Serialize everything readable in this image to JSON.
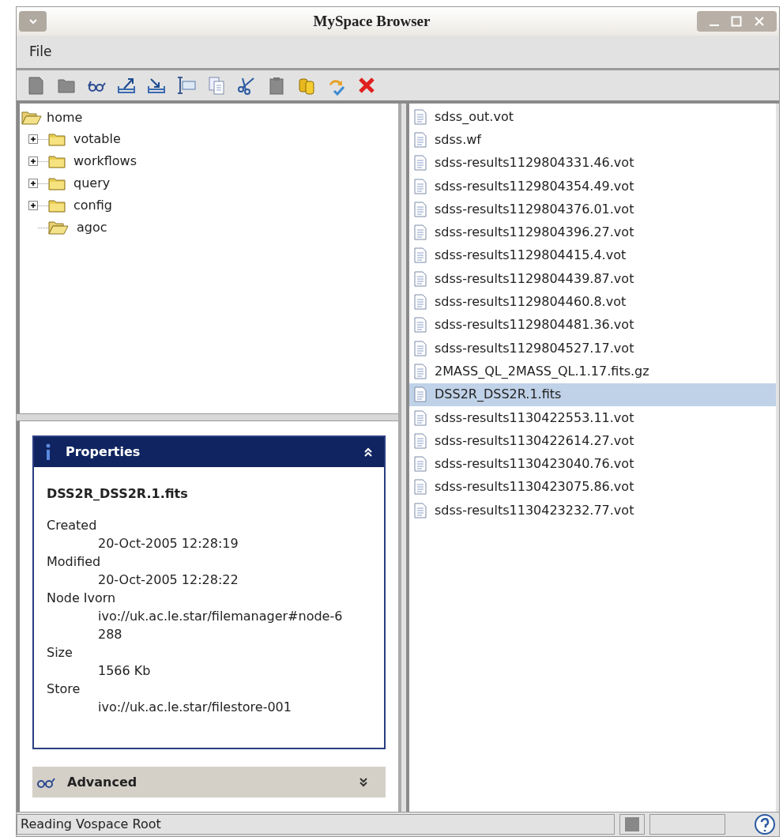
{
  "window": {
    "title": "MySpace Browser"
  },
  "menu": [
    "File"
  ],
  "toolbar": [
    {
      "kind": "new-file",
      "disabled": true
    },
    {
      "kind": "new-folder",
      "disabled": true
    },
    {
      "kind": "view",
      "disabled": false
    },
    {
      "kind": "upload",
      "disabled": false
    },
    {
      "kind": "download",
      "disabled": false
    },
    {
      "kind": "rename",
      "disabled": false
    },
    {
      "kind": "copy",
      "disabled": false
    },
    {
      "kind": "cut",
      "disabled": false
    },
    {
      "kind": "paste",
      "disabled": true
    },
    {
      "kind": "cylinders",
      "disabled": false
    },
    {
      "kind": "refresh",
      "disabled": false
    },
    {
      "kind": "delete",
      "disabled": false
    }
  ],
  "tree": {
    "label": "home",
    "expanded": true,
    "children": [
      {
        "label": "votable",
        "kind": "folder",
        "expanded": false
      },
      {
        "label": "workflows",
        "kind": "folder",
        "expanded": false
      },
      {
        "label": "query",
        "kind": "folder",
        "expanded": false
      },
      {
        "label": "config",
        "kind": "folder",
        "expanded": false
      },
      {
        "label": "agoc",
        "kind": "open-folder"
      }
    ]
  },
  "files": [
    {
      "name": "sdss_out.vot",
      "selected": false
    },
    {
      "name": "sdss.wf",
      "selected": false
    },
    {
      "name": "sdss-results1129804331.46.vot",
      "selected": false
    },
    {
      "name": "sdss-results1129804354.49.vot",
      "selected": false
    },
    {
      "name": "sdss-results1129804376.01.vot",
      "selected": false
    },
    {
      "name": "sdss-results1129804396.27.vot",
      "selected": false
    },
    {
      "name": "sdss-results1129804415.4.vot",
      "selected": false
    },
    {
      "name": "sdss-results1129804439.87.vot",
      "selected": false
    },
    {
      "name": "sdss-results1129804460.8.vot",
      "selected": false
    },
    {
      "name": "sdss-results1129804481.36.vot",
      "selected": false
    },
    {
      "name": "sdss-results1129804527.17.vot",
      "selected": false
    },
    {
      "name": "2MASS_QL_2MASS_QL.1.17.fits.gz",
      "selected": false
    },
    {
      "name": "DSS2R_DSS2R.1.fits",
      "selected": true
    },
    {
      "name": "sdss-results1130422553.11.vot",
      "selected": false
    },
    {
      "name": "sdss-results1130422614.27.vot",
      "selected": false
    },
    {
      "name": "sdss-results1130423040.76.vot",
      "selected": false
    },
    {
      "name": "sdss-results1130423075.86.vot",
      "selected": false
    },
    {
      "name": "sdss-results1130423232.77.vot",
      "selected": false
    }
  ],
  "properties": {
    "title": "Properties",
    "expanded": true,
    "name": "DSS2R_DSS2R.1.fits",
    "fields": [
      {
        "label": "Created",
        "value": "20-Oct-2005 12:28:19"
      },
      {
        "label": "Modified",
        "value": "20-Oct-2005 12:28:22"
      },
      {
        "label": "Node Ivorn",
        "value": "ivo://uk.ac.le.star/filemanager#node-6288"
      },
      {
        "label": "Size",
        "value": "1566 Kb"
      },
      {
        "label": "Store",
        "value": "ivo://uk.ac.le.star/filestore-001"
      }
    ]
  },
  "advanced": {
    "title": "Advanced",
    "expanded": false
  },
  "status_bar": {
    "text": "Reading Vospace Root"
  }
}
